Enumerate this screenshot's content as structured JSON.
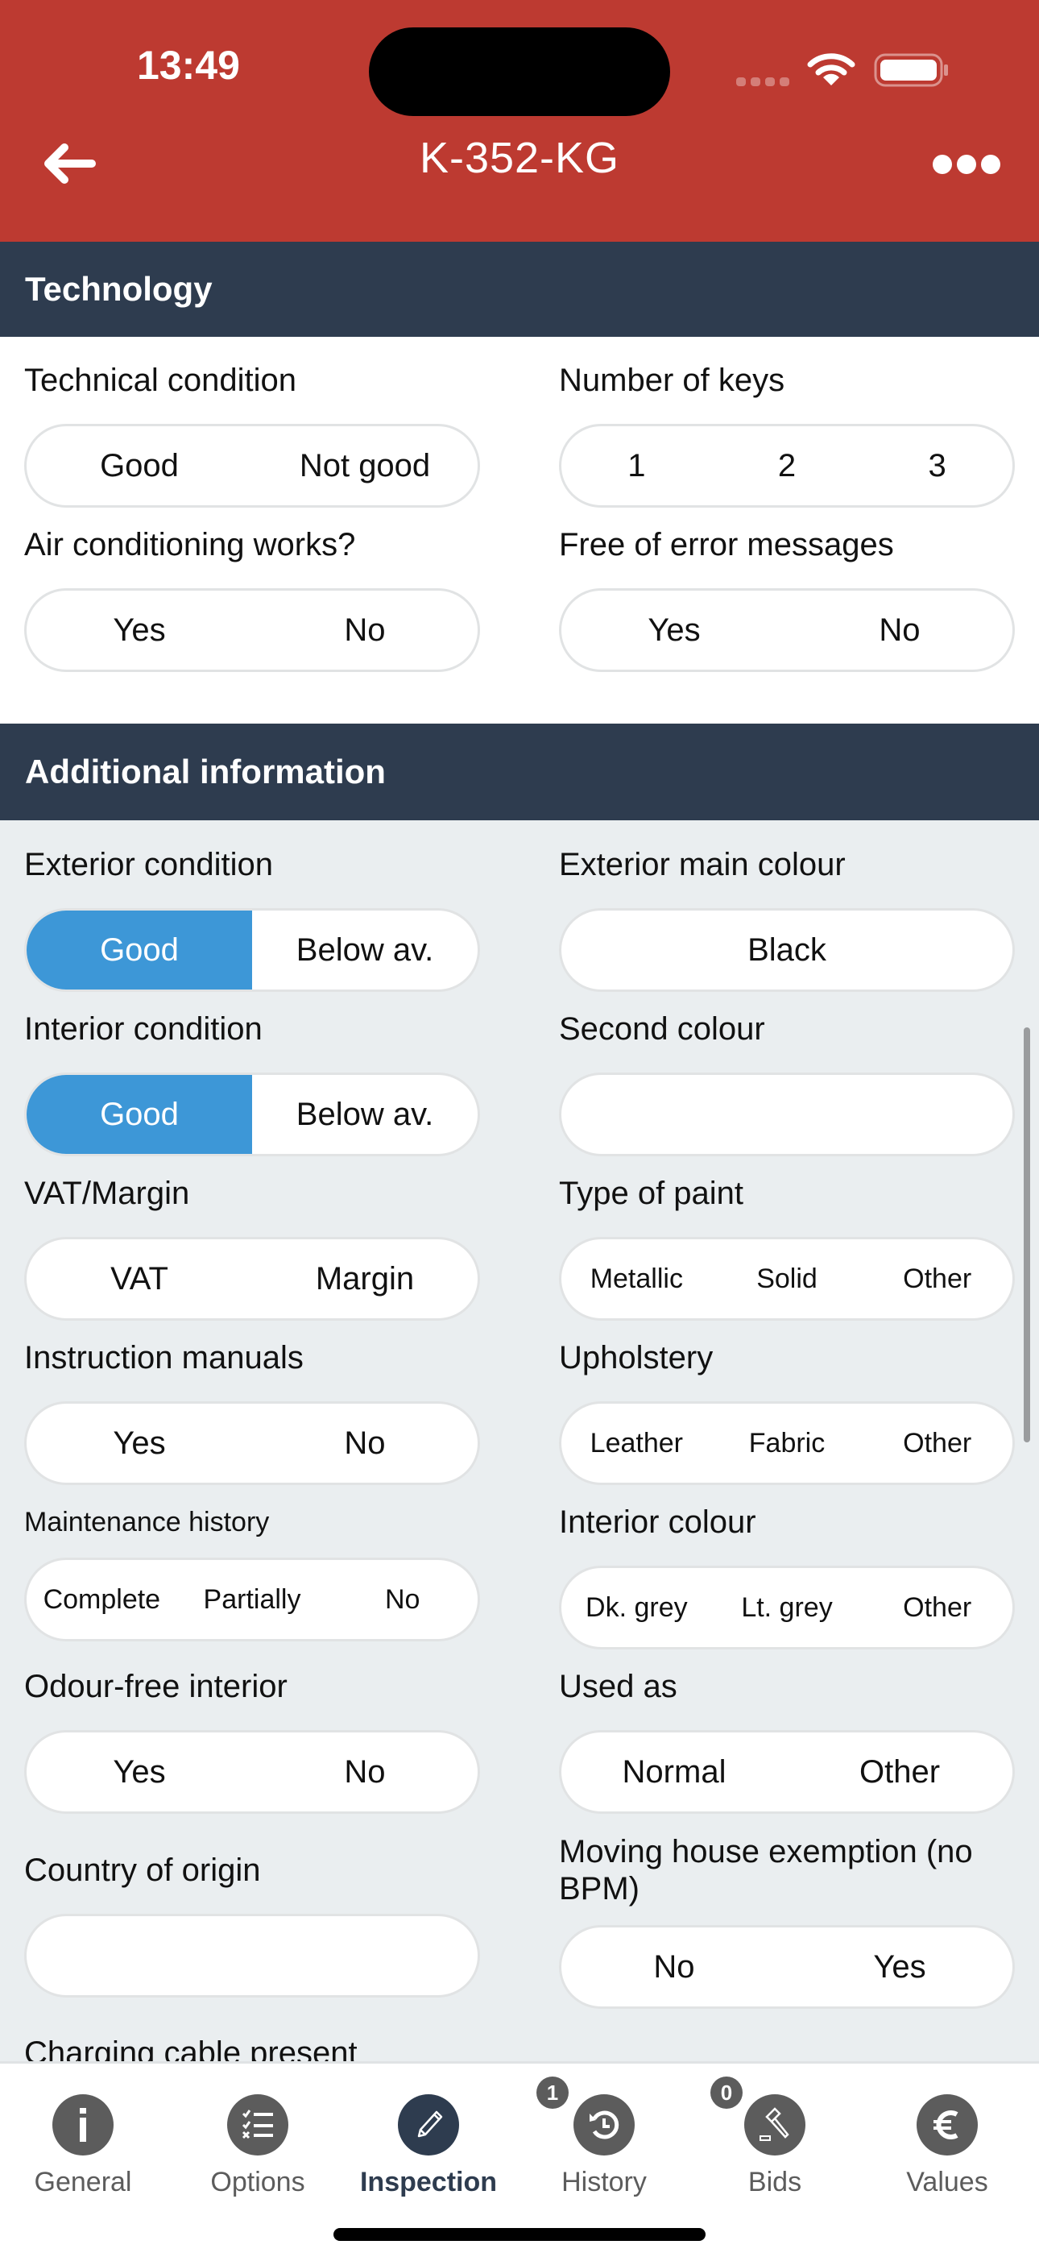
{
  "status_bar": {
    "time": "13:49"
  },
  "header": {
    "title": "K-352-KG",
    "back_icon": "arrow-left-icon",
    "more_icon": "ellipsis-icon"
  },
  "sections": {
    "technology": {
      "title": "Technology",
      "fields": {
        "technical_condition": {
          "label": "Technical condition",
          "options": [
            "Good",
            "Not good"
          ],
          "selected": null
        },
        "number_of_keys": {
          "label": "Number of keys",
          "options": [
            "1",
            "2",
            "3"
          ],
          "selected": null
        },
        "air_conditioning": {
          "label": "Air conditioning works?",
          "options": [
            "Yes",
            "No"
          ],
          "selected": null
        },
        "error_messages": {
          "label": "Free of error messages",
          "options": [
            "Yes",
            "No"
          ],
          "selected": null
        }
      }
    },
    "additional": {
      "title": "Additional information",
      "fields": {
        "exterior_condition": {
          "label": "Exterior condition",
          "options": [
            "Good",
            "Below av."
          ],
          "selected": "Good"
        },
        "exterior_main_colour": {
          "label": "Exterior main colour",
          "value": "Black"
        },
        "interior_condition": {
          "label": "Interior condition",
          "options": [
            "Good",
            "Below av."
          ],
          "selected": "Good"
        },
        "second_colour": {
          "label": "Second colour",
          "value": ""
        },
        "vat_margin": {
          "label": "VAT/Margin",
          "options": [
            "VAT",
            "Margin"
          ],
          "selected": null
        },
        "type_of_paint": {
          "label": "Type of paint",
          "options": [
            "Metallic",
            "Solid",
            "Other"
          ],
          "selected": null
        },
        "instruction_manuals": {
          "label": "Instruction manuals",
          "options": [
            "Yes",
            "No"
          ],
          "selected": null
        },
        "upholstery": {
          "label": "Upholstery",
          "options": [
            "Leather",
            "Fabric",
            "Other"
          ],
          "selected": null
        },
        "maintenance_history": {
          "label": "Maintenance history",
          "options": [
            "Complete",
            "Partially",
            "No"
          ],
          "selected": null
        },
        "interior_colour": {
          "label": "Interior colour",
          "options": [
            "Dk. grey",
            "Lt. grey",
            "Other"
          ],
          "selected": null
        },
        "odour_free": {
          "label": "Odour-free interior",
          "options": [
            "Yes",
            "No"
          ],
          "selected": null
        },
        "used_as": {
          "label": "Used as",
          "options": [
            "Normal",
            "Other"
          ],
          "selected": null
        },
        "country_of_origin": {
          "label": "Country of origin",
          "value": ""
        },
        "moving_house": {
          "label": "Moving house exemption (no BPM)",
          "options": [
            "No",
            "Yes"
          ],
          "selected": null
        },
        "charging_cable": {
          "label": "Charging cable present"
        }
      }
    }
  },
  "tabbar": {
    "tabs": [
      {
        "label": "General",
        "icon": "info-icon",
        "active": false,
        "badge": null
      },
      {
        "label": "Options",
        "icon": "checklist-icon",
        "active": false,
        "badge": null
      },
      {
        "label": "Inspection",
        "icon": "pencil-icon",
        "active": true,
        "badge": null
      },
      {
        "label": "History",
        "icon": "history-icon",
        "active": false,
        "badge": "1"
      },
      {
        "label": "Bids",
        "icon": "gavel-icon",
        "active": false,
        "badge": "0"
      },
      {
        "label": "Values",
        "icon": "euro-icon",
        "active": false,
        "badge": null
      }
    ]
  },
  "colors": {
    "header_red": "#bd3a31",
    "section_navy": "#2e3c4f",
    "selected_blue": "#3d97d7",
    "tab_grey": "#5c5c5c"
  }
}
